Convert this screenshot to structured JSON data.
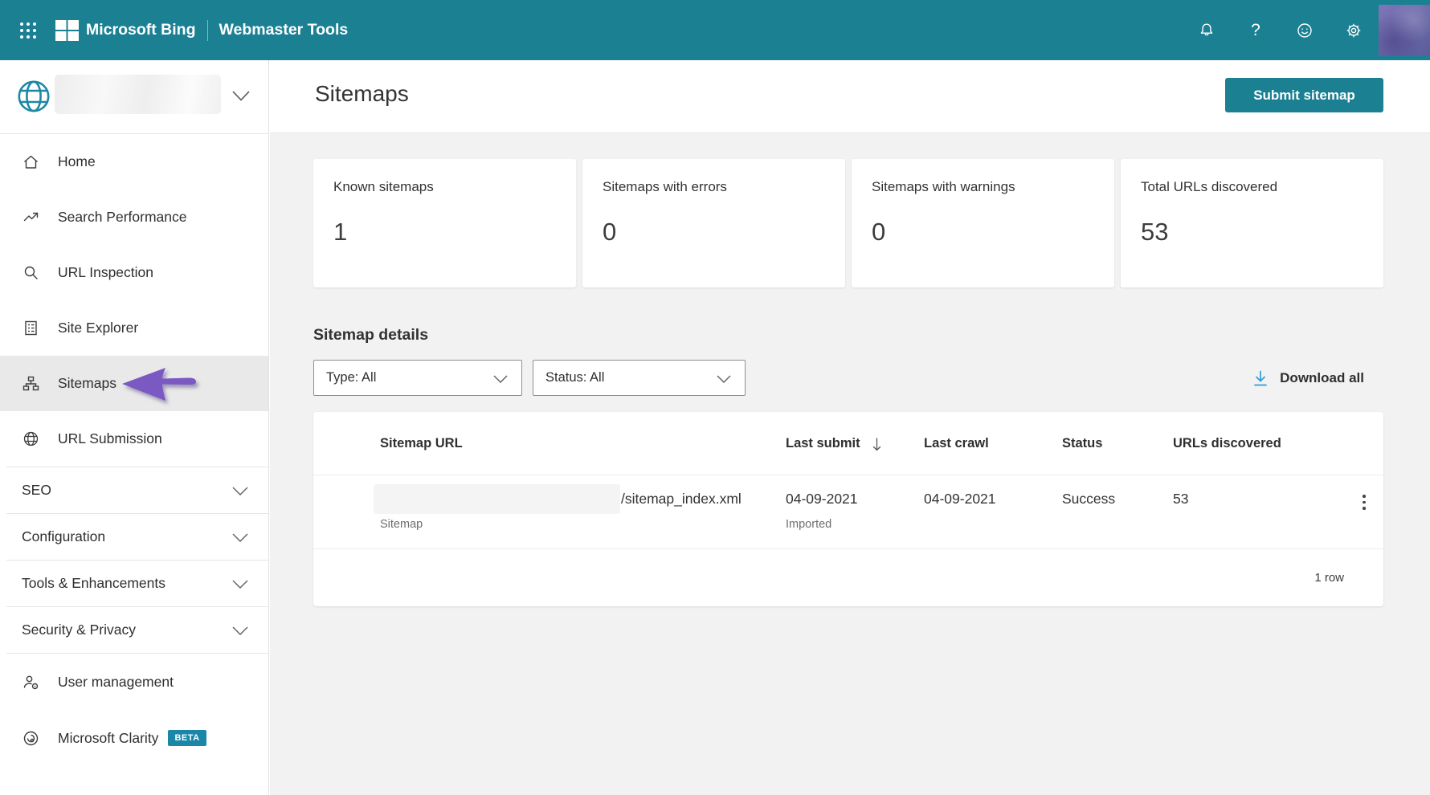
{
  "topbar": {
    "brand": "Microsoft Bing",
    "product": "Webmaster Tools",
    "help_glyph": "?"
  },
  "sidebar": {
    "items": [
      {
        "label": "Home",
        "icon": "home-icon"
      },
      {
        "label": "Search Performance",
        "icon": "trending-up-icon"
      },
      {
        "label": "URL Inspection",
        "icon": "magnifier-icon"
      },
      {
        "label": "Site Explorer",
        "icon": "document-list-icon"
      },
      {
        "label": "Sitemaps",
        "icon": "sitemap-icon",
        "selected": true
      },
      {
        "label": "URL Submission",
        "icon": "globe-icon"
      }
    ],
    "groups": [
      {
        "label": "SEO"
      },
      {
        "label": "Configuration"
      },
      {
        "label": "Tools & Enhancements"
      },
      {
        "label": "Security & Privacy"
      }
    ],
    "footer_items": [
      {
        "label": "User management",
        "icon": "user-settings-icon"
      },
      {
        "label": "Microsoft Clarity",
        "icon": "clarity-icon",
        "badge": "BETA"
      }
    ]
  },
  "header": {
    "title": "Sitemaps",
    "submit_button": "Submit sitemap"
  },
  "stats": [
    {
      "label": "Known sitemaps",
      "value": "1"
    },
    {
      "label": "Sitemaps with errors",
      "value": "0"
    },
    {
      "label": "Sitemaps with warnings",
      "value": "0"
    },
    {
      "label": "Total URLs discovered",
      "value": "53"
    }
  ],
  "details": {
    "heading": "Sitemap details",
    "filters": [
      {
        "value": "Type: All"
      },
      {
        "value": "Status: All"
      }
    ],
    "download_all": "Download all"
  },
  "table": {
    "columns": [
      "Sitemap URL",
      "Last submit",
      "Last crawl",
      "Status",
      "URLs discovered"
    ],
    "row": {
      "url_suffix": "/sitemap_index.xml",
      "type": "Sitemap",
      "last_submit": "04-09-2021",
      "submit_note": "Imported",
      "last_crawl": "04-09-2021",
      "status": "Success",
      "urls_discovered": "53"
    },
    "footer": "1 row"
  },
  "colors": {
    "teal": "#1C8093",
    "beta_badge": "#1A87A8",
    "download_icon": "#2F9CD6",
    "arrow_purple": "#7A59C2"
  }
}
